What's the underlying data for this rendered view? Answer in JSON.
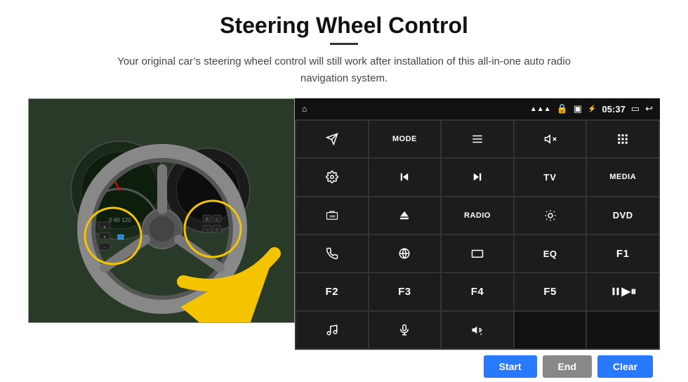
{
  "page": {
    "title": "Steering Wheel Control",
    "subtitle": "Your original car's steering wheel control will still work after installation of this all-in-one auto radio navigation system.",
    "divider": true
  },
  "statusBar": {
    "homeIcon": "⌂",
    "wifiIcon": "wifi",
    "lockIcon": "lock",
    "simIcon": "sim",
    "btIcon": "bt",
    "time": "05:37",
    "screenIcon": "screen",
    "backIcon": "back"
  },
  "buttons": [
    {
      "id": "b1",
      "label": "",
      "icon": "send",
      "row": 1,
      "col": 1
    },
    {
      "id": "b2",
      "label": "MODE",
      "row": 1,
      "col": 2
    },
    {
      "id": "b3",
      "label": "",
      "icon": "list",
      "row": 1,
      "col": 3
    },
    {
      "id": "b4",
      "label": "",
      "icon": "mute",
      "row": 1,
      "col": 4
    },
    {
      "id": "b5",
      "label": "",
      "icon": "apps",
      "row": 1,
      "col": 5
    },
    {
      "id": "b6",
      "label": "",
      "icon": "settings",
      "row": 2,
      "col": 1
    },
    {
      "id": "b7",
      "label": "",
      "icon": "prev",
      "row": 2,
      "col": 2
    },
    {
      "id": "b8",
      "label": "",
      "icon": "next",
      "row": 2,
      "col": 3
    },
    {
      "id": "b9",
      "label": "TV",
      "row": 2,
      "col": 4
    },
    {
      "id": "b10",
      "label": "MEDIA",
      "row": 2,
      "col": 5
    },
    {
      "id": "b11",
      "label": "",
      "icon": "360",
      "row": 3,
      "col": 1
    },
    {
      "id": "b12",
      "label": "",
      "icon": "eject",
      "row": 3,
      "col": 2
    },
    {
      "id": "b13",
      "label": "RADIO",
      "row": 3,
      "col": 3
    },
    {
      "id": "b14",
      "label": "",
      "icon": "brightness",
      "row": 3,
      "col": 4
    },
    {
      "id": "b15",
      "label": "DVD",
      "row": 3,
      "col": 5
    },
    {
      "id": "b16",
      "label": "",
      "icon": "phone",
      "row": 4,
      "col": 1
    },
    {
      "id": "b17",
      "label": "",
      "icon": "browse",
      "row": 4,
      "col": 2
    },
    {
      "id": "b18",
      "label": "",
      "icon": "screen-small",
      "row": 4,
      "col": 3
    },
    {
      "id": "b19",
      "label": "EQ",
      "row": 4,
      "col": 4
    },
    {
      "id": "b20",
      "label": "F1",
      "row": 4,
      "col": 5
    },
    {
      "id": "b21",
      "label": "F2",
      "row": 5,
      "col": 1
    },
    {
      "id": "b22",
      "label": "F3",
      "row": 5,
      "col": 2
    },
    {
      "id": "b23",
      "label": "F4",
      "row": 5,
      "col": 3
    },
    {
      "id": "b24",
      "label": "F5",
      "row": 5,
      "col": 4
    },
    {
      "id": "b25",
      "label": "",
      "icon": "play-pause",
      "row": 5,
      "col": 5
    },
    {
      "id": "b26",
      "label": "",
      "icon": "music",
      "row": 6,
      "col": 1
    },
    {
      "id": "b27",
      "label": "",
      "icon": "mic",
      "row": 6,
      "col": 2
    },
    {
      "id": "b28",
      "label": "",
      "icon": "vol-phone",
      "row": 6,
      "col": 3
    }
  ],
  "bottomBar": {
    "startLabel": "Start",
    "endLabel": "End",
    "clearLabel": "Clear"
  }
}
